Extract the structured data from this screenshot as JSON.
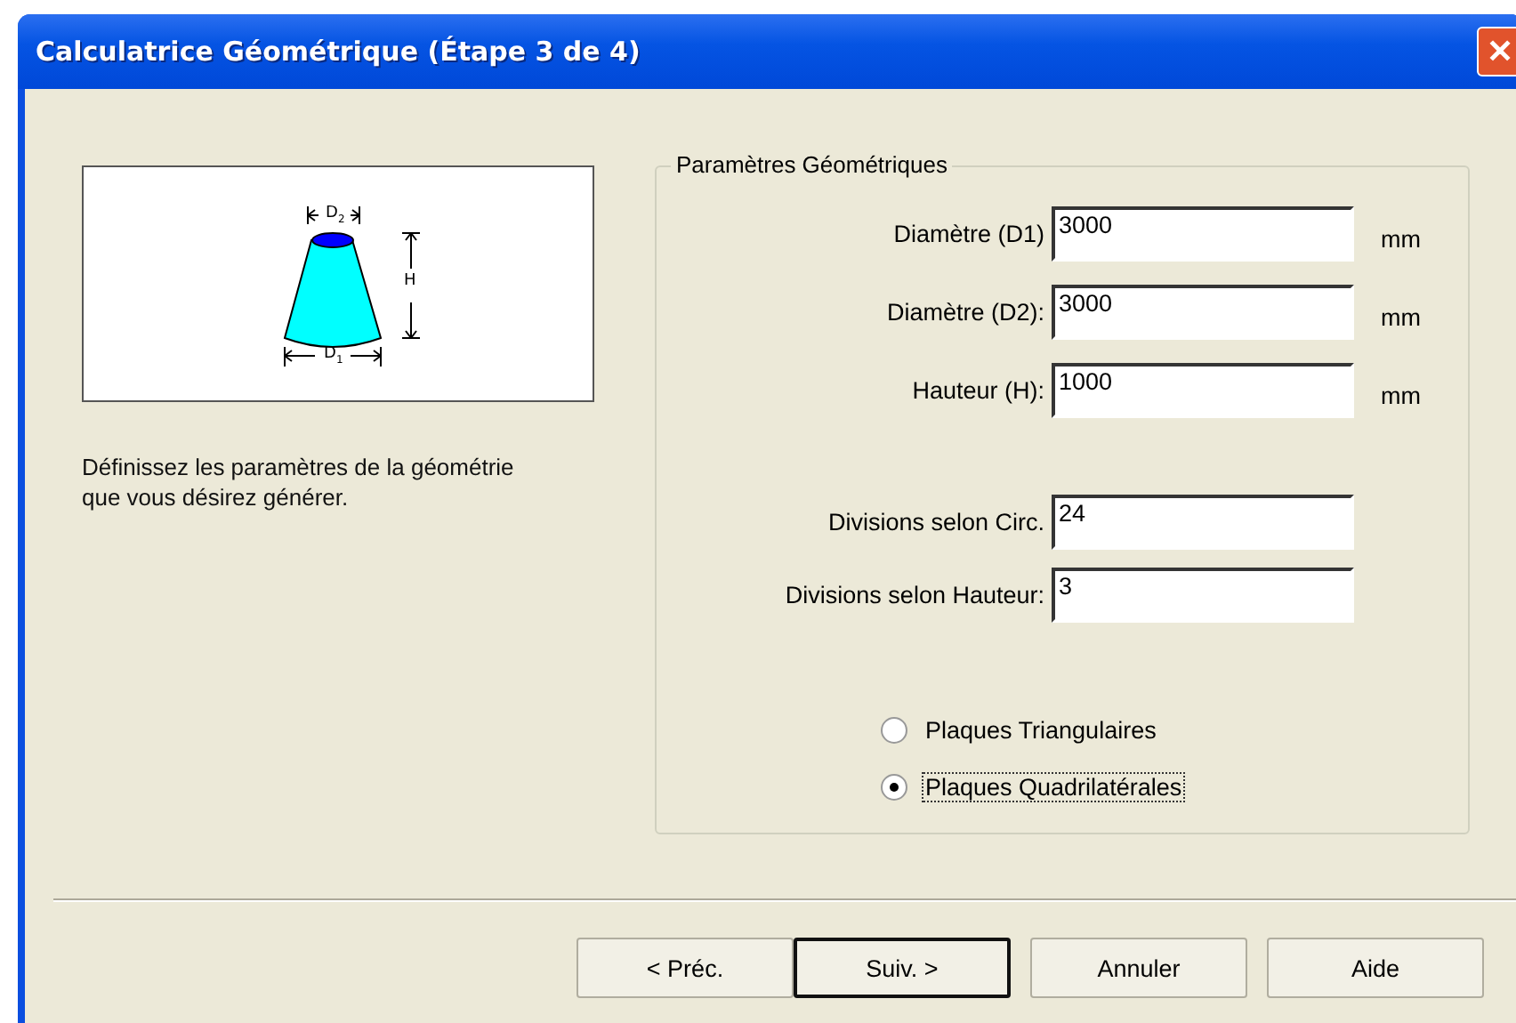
{
  "window": {
    "title": "Calculatrice Géométrique (Étape 3 de 4)",
    "close": "✕"
  },
  "diagram": {
    "labels": [
      "D$_{2}$",
      "H",
      "D$_{1}$"
    ]
  },
  "description": "Définissez les paramètres de la géométrie que vous désirez générer.",
  "group": {
    "title": "Paramètres Géométriques",
    "fields": [
      {
        "label": "Diamètre (D1)",
        "value": "3000",
        "unit": "mm"
      },
      {
        "label": "Diamètre (D2):",
        "value": "3000",
        "unit": "mm"
      },
      {
        "label": "Hauteur (H):",
        "value": "1000",
        "unit": "mm"
      }
    ],
    "divisions": [
      {
        "label": "Divisions selon Circ.",
        "value": "24"
      },
      {
        "label": "Divisions selon Hauteur:",
        "value": "3"
      }
    ],
    "options": [
      {
        "label": "Plaques Triangulaires",
        "selected": false,
        "focused": false
      },
      {
        "label": "Plaques Quadrilatérales",
        "selected": true,
        "focused": true
      }
    ]
  },
  "buttons": [
    {
      "label": "< Préc.",
      "default": false
    },
    {
      "label": "Suiv. >",
      "default": true
    },
    {
      "label": "Annuler",
      "default": false
    },
    {
      "label": "Aide",
      "default": false
    }
  ]
}
